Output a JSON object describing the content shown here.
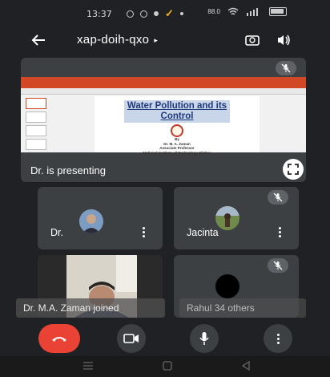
{
  "status_bar": {
    "time": "13:37",
    "signal_text": "88.0"
  },
  "header": {
    "meeting_code": "xap-doih-qxo",
    "caret": "▸"
  },
  "presentation": {
    "slide_title_line1": "Water Pollution and its",
    "slide_title_line2": "Control",
    "slide_by": "By",
    "slide_author": "Dr. M. A. Zaman",
    "slide_role": "Associate Professor",
    "slide_institute": "National Institute of Technology Silchar",
    "presenting_label": "Dr. is presenting"
  },
  "participants": [
    {
      "name": "Dr."
    },
    {
      "name": "Jacinta"
    }
  ],
  "notifications": {
    "joined_toast": "Dr. M.A. Zaman joined",
    "others_name": "Rahul",
    "others_count": "34 others"
  },
  "colors": {
    "end_call": "#ea4335",
    "tile_bg": "#3c4043",
    "background": "#202124",
    "ppt_ribbon": "#d24726"
  },
  "icons": {
    "back": "arrow-left-icon",
    "flip_camera": "flip-camera-icon",
    "speaker": "speaker-icon",
    "mic_off": "mic-off-icon",
    "fullscreen": "fullscreen-icon",
    "end_call": "phone-hangup-icon",
    "camera": "video-camera-icon",
    "mic": "microphone-icon",
    "more": "more-vertical-icon"
  }
}
